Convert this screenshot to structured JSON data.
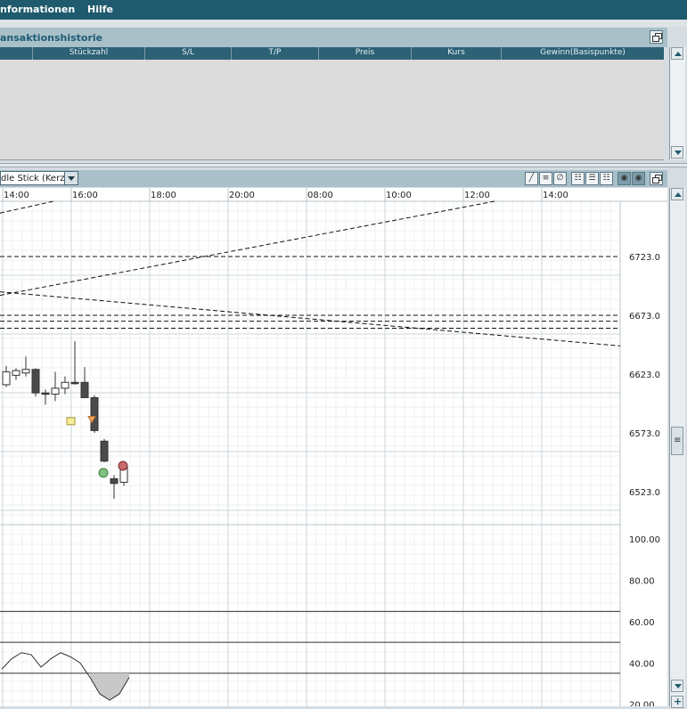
{
  "menu": {
    "informationen": "nformationen",
    "hilfe": "Hilfe"
  },
  "history_panel": {
    "title": "ansaktionshistorie",
    "columns": [
      "Stückzahl",
      "S/L",
      "T/P",
      "Preis",
      "Kurs",
      "Gewinn(Basispunkte)"
    ]
  },
  "chart_toolbar": {
    "chart_type": "dle Stick (Kerze",
    "tools": [
      "draw-line-icon",
      "horizontal-lines-icon",
      "no-draw-icon",
      "grid-layout-a-icon",
      "grid-layout-b-icon",
      "grid-layout-c-icon",
      "toggle-round-a-icon",
      "toggle-round-b-icon",
      "restore-window-icon"
    ]
  },
  "chart_data": {
    "type": "candlestick",
    "time_ticks": [
      "14:00",
      "16:00",
      "18:00",
      "20:00",
      "08:00",
      "10:00",
      "12:00",
      "14:00"
    ],
    "price_ticks": [
      "6723.0",
      "6673.0",
      "6623.0",
      "6573.0",
      "6523.0"
    ],
    "price_range": [
      6495,
      6770
    ],
    "horizontal_levels": [
      6723,
      6673,
      6668,
      6662
    ],
    "candles": [
      {
        "open": 6614,
        "high": 6630,
        "low": 6612,
        "close": 6625
      },
      {
        "open": 6622,
        "high": 6628,
        "low": 6618,
        "close": 6626
      },
      {
        "open": 6624,
        "high": 6638,
        "low": 6621,
        "close": 6627
      },
      {
        "open": 6627,
        "high": 6628,
        "low": 6604,
        "close": 6607
      },
      {
        "open": 6607,
        "high": 6610,
        "low": 6597,
        "close": 6606
      },
      {
        "open": 6606,
        "high": 6625,
        "low": 6600,
        "close": 6611
      },
      {
        "open": 6611,
        "high": 6621,
        "low": 6606,
        "close": 6616
      },
      {
        "open": 6616,
        "high": 6651,
        "low": 6614,
        "close": 6615
      },
      {
        "open": 6616,
        "high": 6629,
        "low": 6604,
        "close": 6603
      },
      {
        "open": 6603,
        "high": 6605,
        "low": 6573,
        "close": 6575
      },
      {
        "open": 6566,
        "high": 6568,
        "low": 6548,
        "close": 6549
      },
      {
        "open": 6534,
        "high": 6537,
        "low": 6517,
        "close": 6530
      },
      {
        "open": 6531,
        "high": 6548,
        "low": 6528,
        "close": 6545
      }
    ],
    "indicator_ticks": [
      "100.00",
      "80.00",
      "60.00",
      "40.00",
      "20.00"
    ],
    "indicator_range": [
      19,
      107
    ],
    "indicator_levels": [
      65,
      50,
      35
    ],
    "indicator_values": [
      37,
      42,
      45,
      44,
      38,
      42,
      45,
      43,
      40,
      33,
      25,
      22,
      25,
      33
    ]
  }
}
